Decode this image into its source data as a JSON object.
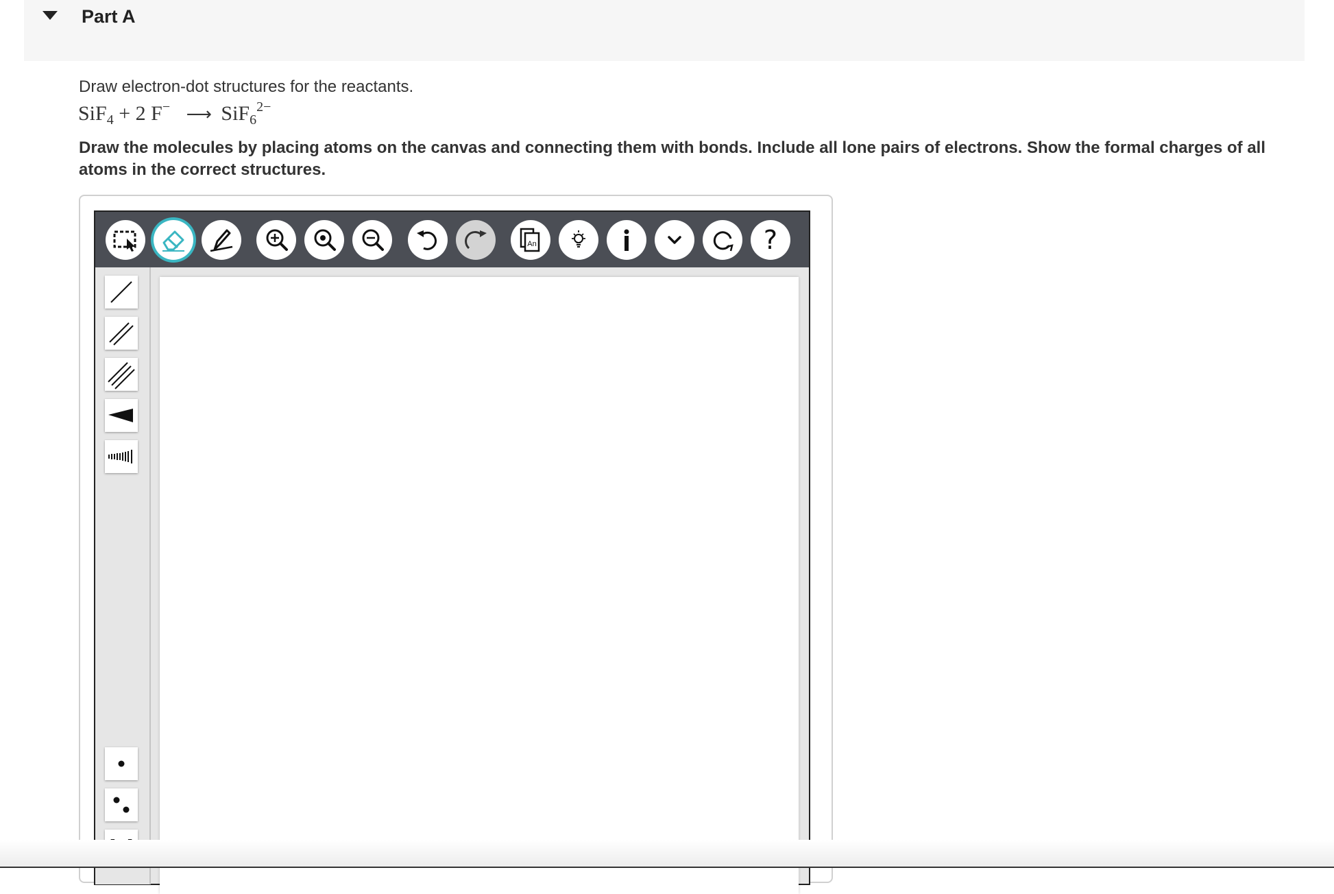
{
  "part": {
    "title": "Part A"
  },
  "question": {
    "prompt": "Draw electron-dot structures for the reactants.",
    "equation": {
      "reactant1": "SiF",
      "reactant1_sub": "4",
      "plus": "+",
      "coef": "2",
      "reactant2": "F",
      "reactant2_sup": "−",
      "arrow": "⟶",
      "product": "SiF",
      "product_sub": "6",
      "product_sup": "2−"
    },
    "instructions": "Draw the molecules by placing atoms on the canvas and connecting them with bonds. Include all lone pairs of electrons. Show the formal charges of all atoms in the correct structures."
  },
  "toolbar": {
    "items": [
      {
        "name": "marquee-select-icon",
        "state": "normal"
      },
      {
        "name": "eraser-icon",
        "state": "active"
      },
      {
        "name": "draw-pencil-icon",
        "state": "normal"
      },
      {
        "name": "zoom-in-icon",
        "state": "normal"
      },
      {
        "name": "zoom-fit-icon",
        "state": "normal"
      },
      {
        "name": "zoom-out-icon",
        "state": "normal"
      },
      {
        "name": "undo-icon",
        "state": "normal"
      },
      {
        "name": "redo-icon",
        "state": "disabled"
      },
      {
        "name": "template-library-icon",
        "state": "normal",
        "label": "An"
      },
      {
        "name": "hint-lightbulb-icon",
        "state": "normal"
      },
      {
        "name": "info-icon",
        "state": "normal"
      },
      {
        "name": "expand-chevron-icon",
        "state": "normal"
      },
      {
        "name": "reset-icon",
        "state": "normal"
      },
      {
        "name": "help-icon",
        "state": "normal",
        "label": "?"
      }
    ],
    "accent_color": "#3ab6c2"
  },
  "sidebar": {
    "tools": [
      {
        "name": "single-bond-icon"
      },
      {
        "name": "double-bond-icon"
      },
      {
        "name": "triple-bond-icon"
      },
      {
        "name": "wedge-bond-icon"
      },
      {
        "name": "hash-bond-icon"
      },
      {
        "name": "single-electron-icon"
      },
      {
        "name": "lone-pair-icon"
      },
      {
        "name": "brackets-icon",
        "label": "[ ]"
      }
    ]
  }
}
